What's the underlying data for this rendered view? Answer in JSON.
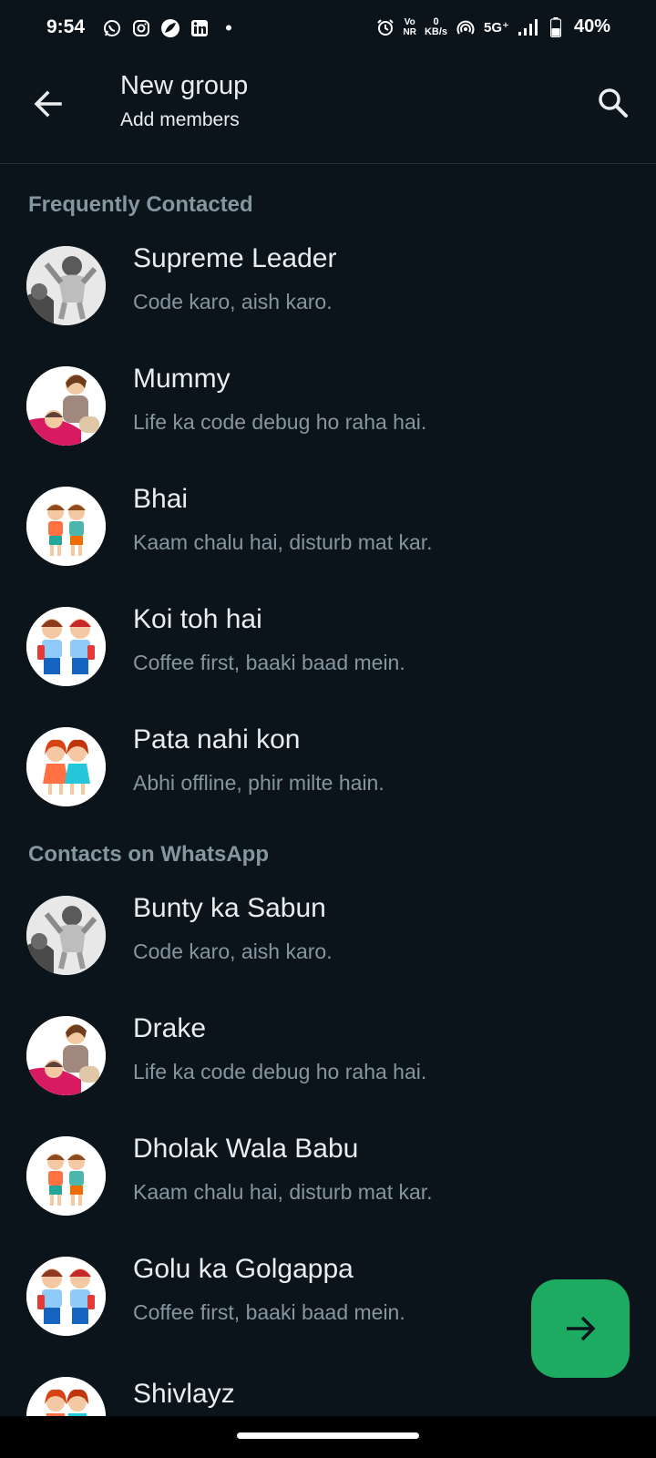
{
  "status_bar": {
    "time": "9:54",
    "net_speed_top": "0",
    "net_speed_unit": "KB/s",
    "volte": "Vo\nNR",
    "network": "5G⁺",
    "battery": "40%",
    "dot": "•"
  },
  "header": {
    "title": "New group",
    "subtitle": "Add members"
  },
  "sections": [
    {
      "title": "Frequently Contacted",
      "contacts": [
        {
          "name": "Supreme Leader",
          "status": "Code karo, aish karo.",
          "avatar": "father-child-photo"
        },
        {
          "name": "Mummy",
          "status": "Life ka code debug ho raha hai.",
          "avatar": "mother-child-cartoon"
        },
        {
          "name": "Bhai",
          "status": "Kaam chalu hai, disturb mat kar.",
          "avatar": "two-kids-cartoon"
        },
        {
          "name": "Koi toh hai",
          "status": "Coffee first, baaki baad mein.",
          "avatar": "two-schoolboys-cartoon"
        },
        {
          "name": "Pata nahi kon",
          "status": "Abhi offline, phir milte hain.",
          "avatar": "two-girls-cartoon"
        }
      ]
    },
    {
      "title": "Contacts on WhatsApp",
      "contacts": [
        {
          "name": "Bunty ka Sabun",
          "status": "Code karo, aish karo.",
          "avatar": "father-child-photo"
        },
        {
          "name": "Drake",
          "status": "Life ka code debug ho raha hai.",
          "avatar": "mother-child-cartoon"
        },
        {
          "name": "Dholak Wala Babu",
          "status": "Kaam chalu hai, disturb mat kar.",
          "avatar": "two-kids-cartoon"
        },
        {
          "name": "Golu ka Golgappa",
          "status": "Coffee first, baaki baad mein.",
          "avatar": "two-schoolboys-cartoon"
        },
        {
          "name": "Shivlayz",
          "status": "",
          "avatar": "two-girls-cartoon"
        }
      ]
    }
  ],
  "colors": {
    "background": "#0b141a",
    "fab": "#1daa61",
    "secondary_text": "#8696a0"
  }
}
